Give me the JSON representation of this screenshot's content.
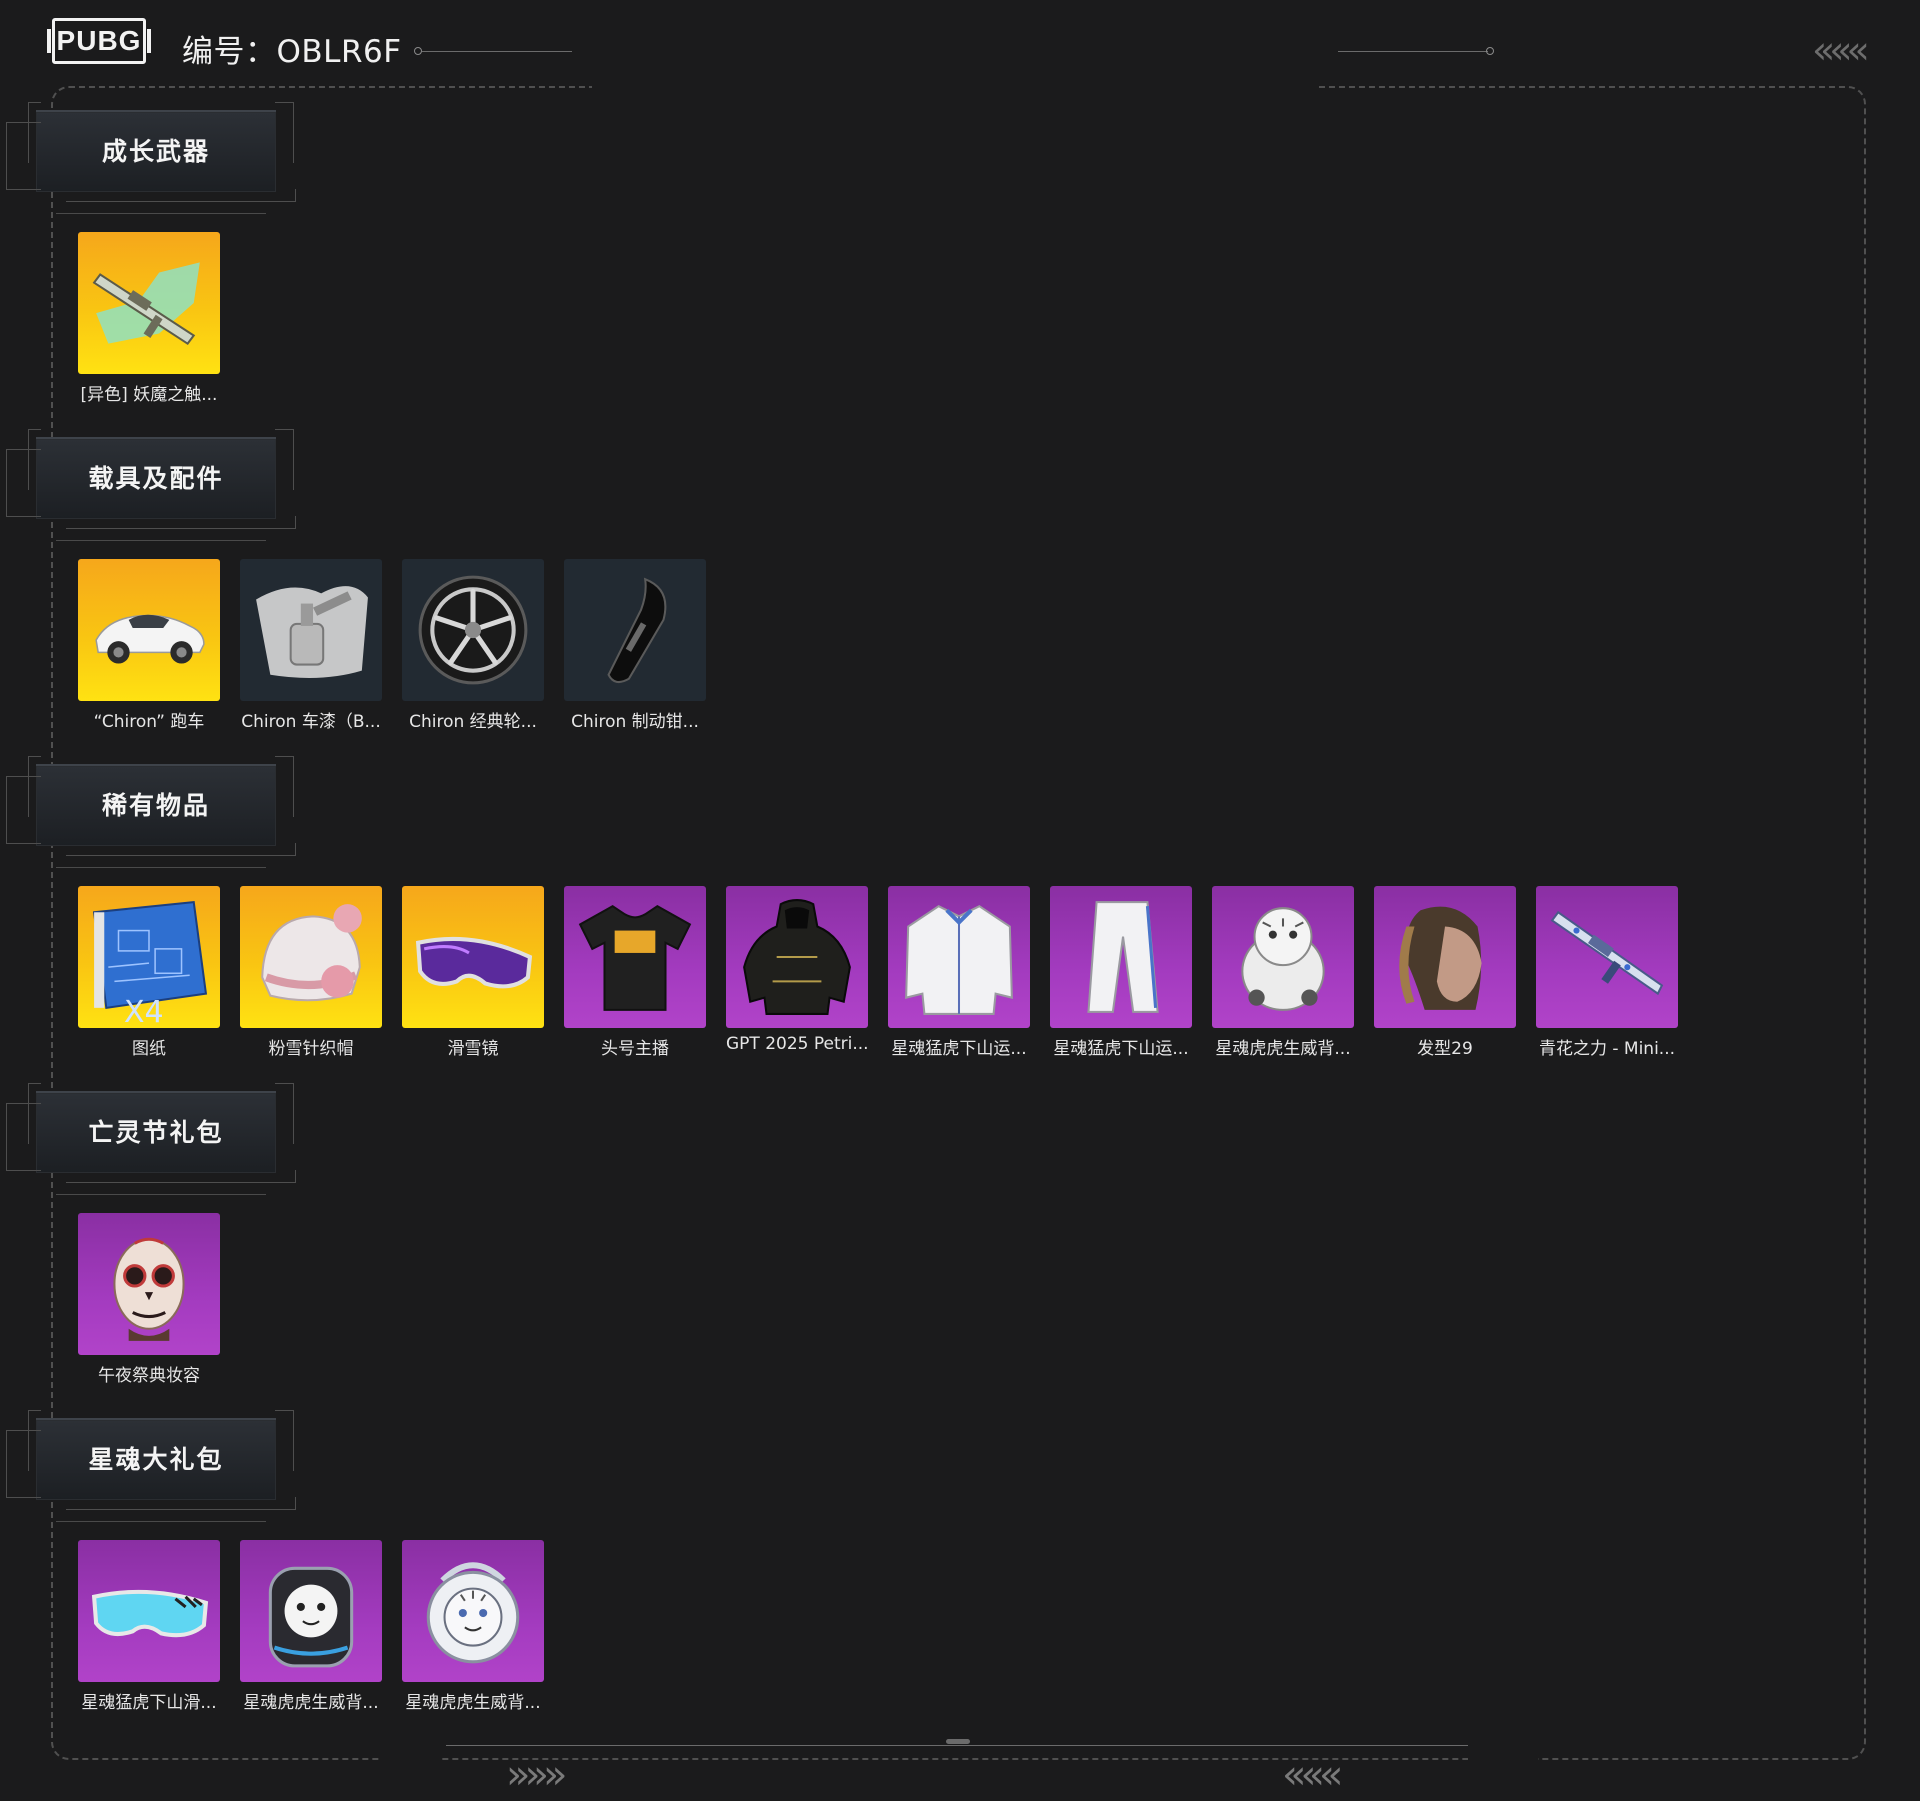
{
  "header": {
    "logo_text": "PUBG",
    "code_text": "编号：OBLR6F"
  },
  "sections": [
    {
      "title": "成长武器",
      "items": [
        {
          "label": "[异色] 妖魔之触...",
          "rarity": "gold",
          "icon": "rifle-icon"
        }
      ]
    },
    {
      "title": "载具及配件",
      "items": [
        {
          "label": "“Chiron” 跑车",
          "rarity": "gold",
          "icon": "car-icon"
        },
        {
          "label": "Chiron 车漆（B...",
          "rarity": "dark",
          "icon": "paint-spray-icon"
        },
        {
          "label": "Chiron 经典轮...",
          "rarity": "dark",
          "icon": "wheel-icon"
        },
        {
          "label": "Chiron 制动钳...",
          "rarity": "dark",
          "icon": "brake-caliper-icon"
        }
      ]
    },
    {
      "title": "稀有物品",
      "items": [
        {
          "label": "图纸",
          "rarity": "gold",
          "icon": "blueprint-icon",
          "badge": "X4"
        },
        {
          "label": "粉雪针织帽",
          "rarity": "gold",
          "icon": "beanie-icon"
        },
        {
          "label": "滑雪镜",
          "rarity": "gold",
          "icon": "goggles-icon"
        },
        {
          "label": "头号主播",
          "rarity": "purple",
          "icon": "tshirt-icon"
        },
        {
          "label": "GPT 2025 Petri...",
          "rarity": "purple",
          "icon": "hooded-jacket-icon"
        },
        {
          "label": "星魂猛虎下山运...",
          "rarity": "purple",
          "icon": "jacket-icon"
        },
        {
          "label": "星魂猛虎下山运...",
          "rarity": "purple",
          "icon": "pants-icon"
        },
        {
          "label": "星魂虎虎生威背...",
          "rarity": "purple",
          "icon": "tiger-backpack-icon"
        },
        {
          "label": "发型29",
          "rarity": "purple",
          "icon": "hairstyle-icon"
        },
        {
          "label": "青花之力 - Mini...",
          "rarity": "purple",
          "icon": "rifle-icon"
        }
      ]
    },
    {
      "title": "亡灵节礼包",
      "items": [
        {
          "label": "午夜祭典妆容",
          "rarity": "purple",
          "icon": "skull-face-icon"
        }
      ]
    },
    {
      "title": "星魂大礼包",
      "items": [
        {
          "label": "星魂猛虎下山滑...",
          "rarity": "purple",
          "icon": "goggles-icon"
        },
        {
          "label": "星魂虎虎生威背...",
          "rarity": "purple",
          "icon": "tiger-backpack-icon"
        },
        {
          "label": "星魂虎虎生威背...",
          "rarity": "purple",
          "icon": "tiger-backpack-icon"
        }
      ]
    }
  ],
  "decor": {
    "chevron_left": "«««",
    "chevron_right": "»»»"
  },
  "colors": {
    "background": "#1b1b1c",
    "gold_tile": "#f9c512",
    "purple_tile": "#a33bbf",
    "dark_tile": "#222a32"
  }
}
